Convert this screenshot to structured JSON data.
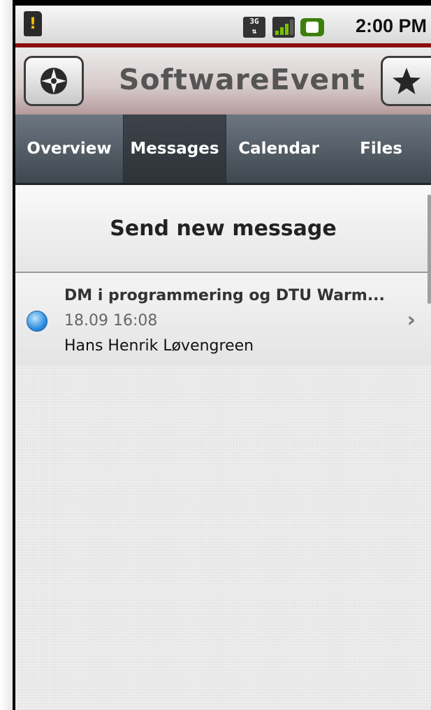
{
  "status_bar": {
    "time": "2:00 PM",
    "network_label": "3G",
    "icons": [
      "sd-card-warning-icon",
      "3g-icon",
      "signal-icon",
      "battery-charging-icon"
    ]
  },
  "app_bar": {
    "title": "SoftwareEvent",
    "left_button_icon": "compass-icon",
    "right_button_icon": "star-icon"
  },
  "tabs": [
    {
      "label": "Overview",
      "active": false
    },
    {
      "label": "Messages",
      "active": true
    },
    {
      "label": "Calendar",
      "active": false
    },
    {
      "label": "Files",
      "active": false
    }
  ],
  "main": {
    "send_button_label": "Send new message",
    "messages": [
      {
        "subject": "DM i programmering og DTU Warm...",
        "date": "18.09 16:08",
        "sender": "Hans Henrik Løvengreen",
        "unread": true
      }
    ]
  },
  "colors": {
    "accent_red": "#8b0f10",
    "tab_bg": "#4a535c",
    "unread_dot": "#2f8ee0"
  }
}
